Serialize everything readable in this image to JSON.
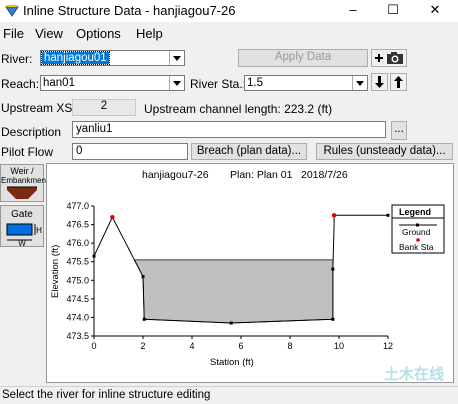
{
  "window": {
    "title": "Inline Structure Data - hanjiagou7-26",
    "minimize": "–",
    "maximize": "☐",
    "close": "✕"
  },
  "menu": [
    "File",
    "View",
    "Options",
    "Help"
  ],
  "river": {
    "label": "River:",
    "value": "hanjiagou01"
  },
  "apply_label": "Apply Data",
  "reach": {
    "label": "Reach:",
    "value": "han01"
  },
  "river_sta": {
    "label": "River Sta.:",
    "value": "1.5"
  },
  "upstream": {
    "label": "Upstream XS:",
    "value": "2",
    "channel_text": "Upstream channel length: 223.2 (ft)"
  },
  "description": {
    "label": "Description",
    "value": "yanliu1",
    "button": "..."
  },
  "pilot": {
    "label": "Pilot Flow",
    "value": "0"
  },
  "breach_label": "Breach (plan data)...",
  "rules_label": "Rules (unsteady data)...",
  "side": {
    "weir_label_1": "Weir /",
    "weir_label_2": "Embankment",
    "gate_label": "Gate",
    "gate_h": "H",
    "gate_w": "W"
  },
  "plot": {
    "project": "hanjiagou7-26",
    "plan": "Plan: Plan 01",
    "date": "2018/7/26"
  },
  "status": "Select the river for inline structure editing",
  "watermark": "土木在线",
  "colors": {
    "fill": "#c0c0c0",
    "bank": "#e00000",
    "ground": "#000000"
  },
  "chart_data": {
    "type": "line",
    "xlabel": "Station (ft)",
    "ylabel": "Elevation (ft)",
    "xlim": [
      0,
      12
    ],
    "ylim": [
      473.5,
      477.0
    ],
    "xticks": [
      "0",
      "2",
      "4",
      "6",
      "8",
      "10",
      "12"
    ],
    "yticks": [
      "473.5",
      "474.0",
      "474.5",
      "475.0",
      "475.5",
      "476.0",
      "476.5",
      "477.0"
    ],
    "ground": {
      "x": [
        0,
        0.75,
        2.0,
        2.05,
        5.6,
        9.75,
        9.75,
        9.8,
        9.8,
        12.0
      ],
      "y": [
        475.65,
        476.7,
        475.1,
        473.95,
        473.85,
        473.95,
        475.3,
        476.5,
        476.75,
        476.75
      ]
    },
    "bank_sta": {
      "x": [
        0.75,
        9.8
      ],
      "y": [
        476.7,
        476.75
      ]
    },
    "fill_top": 475.55,
    "legend": {
      "title": "Legend",
      "items": [
        "Ground",
        "Bank Sta"
      ]
    },
    "grid": false
  }
}
